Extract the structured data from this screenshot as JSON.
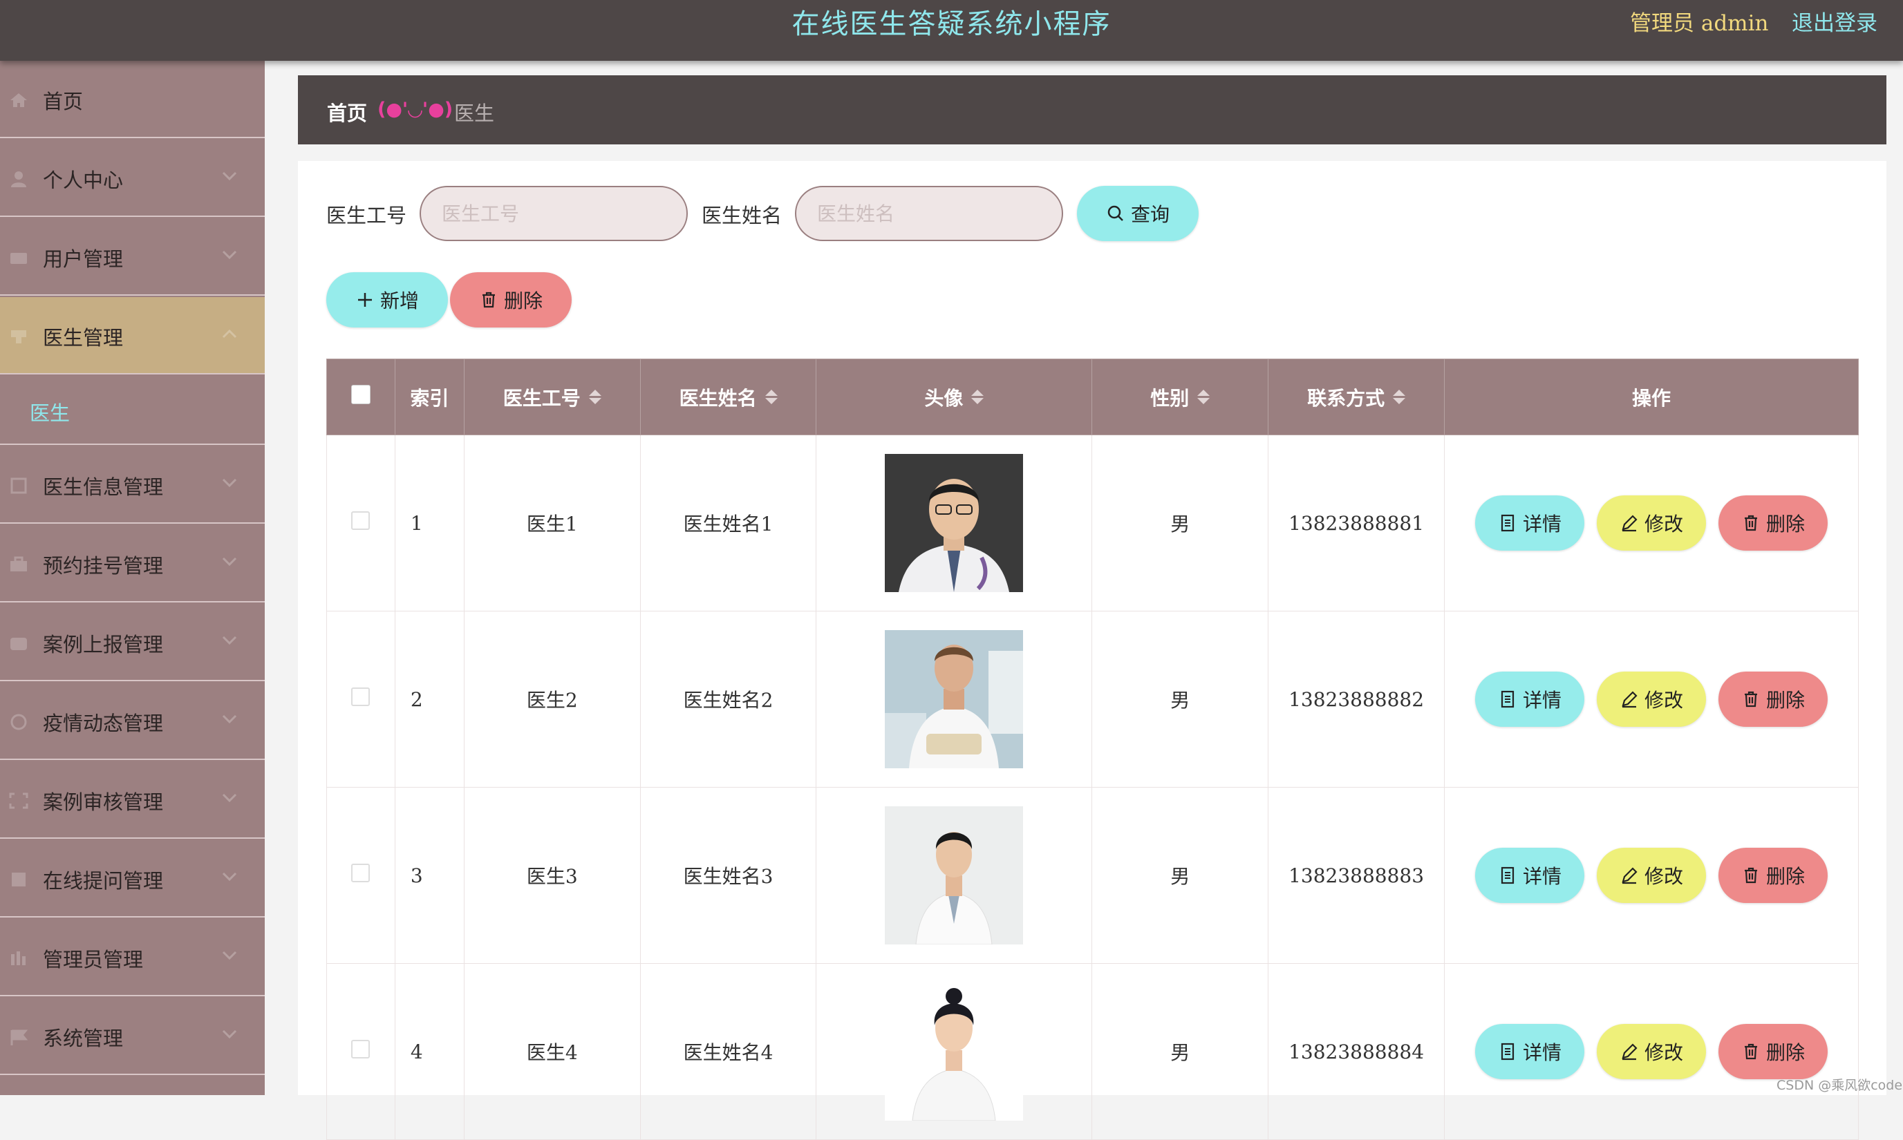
{
  "header": {
    "title": "在线医生答疑系统小程序",
    "admin_label": "管理员 admin",
    "logout_label": "退出登录"
  },
  "sidebar": {
    "items": [
      {
        "label": "首页",
        "icon": "home-icon"
      },
      {
        "label": "个人中心",
        "icon": "user-icon"
      },
      {
        "label": "用户管理",
        "icon": "users-icon"
      },
      {
        "label": "医生管理",
        "icon": "doctor-icon"
      },
      {
        "label": "医生信息管理",
        "icon": "document-icon"
      },
      {
        "label": "预约挂号管理",
        "icon": "briefcase-icon"
      },
      {
        "label": "案例上报管理",
        "icon": "report-icon"
      },
      {
        "label": "疫情动态管理",
        "icon": "globe-icon"
      },
      {
        "label": "案例审核管理",
        "icon": "audit-icon"
      },
      {
        "label": "在线提问管理",
        "icon": "question-icon"
      },
      {
        "label": "管理员管理",
        "icon": "admin-icon"
      },
      {
        "label": "系统管理",
        "icon": "flag-icon"
      }
    ],
    "active_index": 3,
    "submenu_label": "医生"
  },
  "breadcrumb": {
    "home": "首页",
    "separator": "(●'◡'●)",
    "current": "医生"
  },
  "filters": {
    "doctor_no_label": "医生工号",
    "doctor_no_placeholder": "医生工号",
    "doctor_name_label": "医生姓名",
    "doctor_name_placeholder": "医生姓名",
    "search_label": "查询"
  },
  "actions": {
    "add_label": "新增",
    "delete_label": "删除"
  },
  "table": {
    "columns": [
      "索引",
      "医生工号",
      "医生姓名",
      "头像",
      "性别",
      "联系方式",
      "操作"
    ],
    "rows": [
      {
        "index": "1",
        "doctor_no": "医生1",
        "doctor_name": "医生姓名1",
        "gender": "男",
        "phone": "13823888881"
      },
      {
        "index": "2",
        "doctor_no": "医生2",
        "doctor_name": "医生姓名2",
        "gender": "男",
        "phone": "13823888882"
      },
      {
        "index": "3",
        "doctor_no": "医生3",
        "doctor_name": "医生姓名3",
        "gender": "男",
        "phone": "13823888883"
      },
      {
        "index": "4",
        "doctor_no": "医生4",
        "doctor_name": "医生姓名4",
        "gender": "男",
        "phone": "13823888884"
      }
    ],
    "row_actions": {
      "detail": "详情",
      "edit": "修改",
      "delete": "删除"
    }
  },
  "watermark": "CSDN @乘风欲code",
  "colors": {
    "header_bg": "#4e4747",
    "sidebar_bg": "#9c8081",
    "active_bg": "#c6ae84",
    "accent_cyan": "#96eceb",
    "accent_red": "#ee8a8a",
    "accent_yellow": "#eef07a",
    "table_head": "#9a7f80"
  }
}
